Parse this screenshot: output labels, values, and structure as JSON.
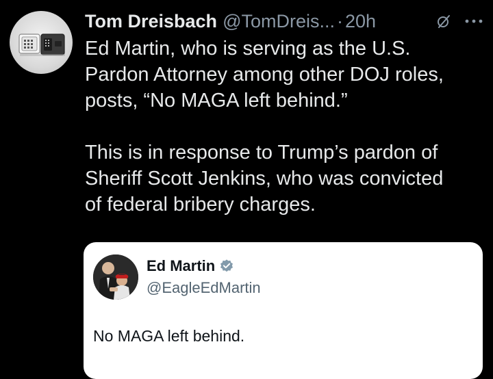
{
  "tweet": {
    "author": {
      "display_name": "Tom Dreisbach",
      "handle": "@TomDreis...",
      "avatar_icon": "safe-icon"
    },
    "separator": "·",
    "timestamp": "20h",
    "header_icons": [
      "grok-icon",
      "more-icon"
    ],
    "paragraphs": [
      "Ed Martin, who is serving as the U.S.\nPardon Attorney among other DOJ roles,\nposts, “No MAGA left behind.”",
      "This is in response to Trump’s pardon of\nSheriff Scott Jenkins, who was convicted\nof federal bribery charges."
    ]
  },
  "quoted_tweet": {
    "display_name": "Ed Martin",
    "handle": "@EagleEdMartin",
    "verified": true,
    "verified_icon": "verified-badge-icon",
    "text": "No MAGA left behind."
  },
  "colors": {
    "background": "#000000",
    "primary_text": "#e7e9ea",
    "secondary_text": "#8b98a5",
    "quote_background": "#ffffff",
    "quote_text": "#0f1419",
    "quote_secondary": "#536471",
    "verified_badge": "#829aab"
  }
}
